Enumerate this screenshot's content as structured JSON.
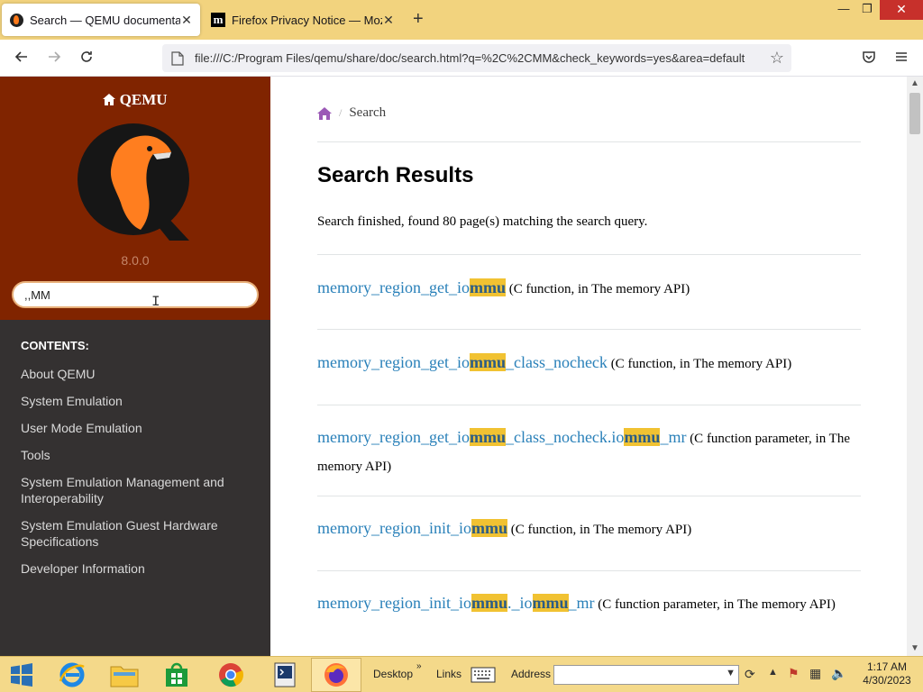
{
  "browser": {
    "tabs": [
      {
        "title": "Search — QEMU documentatio",
        "close": "✕",
        "favicon": "qemu-logo-icon",
        "active": true
      },
      {
        "title": "Firefox Privacy Notice — Mozilla",
        "close": "✕",
        "favicon": "mozilla-m-icon",
        "active": false
      }
    ],
    "new_tab": "+",
    "url": "file:///C:/Program Files/qemu/share/doc/search.html?q=%2C%2CMM&check_keywords=yes&area=default",
    "window_controls": {
      "minimize": "—",
      "maximize": "❐",
      "close": "✕"
    }
  },
  "sidebar": {
    "brand": "QEMU",
    "version": "8.0.0",
    "search_value": ",,MM",
    "contents_heading": "CONTENTS:",
    "nav_items": [
      "About QEMU",
      "System Emulation",
      "User Mode Emulation",
      "Tools",
      "System Emulation Management and Interoperability",
      "System Emulation Guest Hardware Specifications",
      "Developer Information"
    ]
  },
  "main": {
    "breadcrumb_current": "Search",
    "heading": "Search Results",
    "summary": "Search finished, found 80 page(s) matching the search query.",
    "results": [
      {
        "parts": [
          [
            "memory_region_get_io",
            false
          ],
          [
            "mmu",
            true
          ]
        ],
        "desc": " (C function, in The memory API)"
      },
      {
        "parts": [
          [
            "memory_region_get_io",
            false
          ],
          [
            "mmu",
            true
          ],
          [
            "_class_nocheck",
            false
          ]
        ],
        "desc": " (C function, in The memory API)"
      },
      {
        "parts": [
          [
            "memory_region_get_io",
            false
          ],
          [
            "mmu",
            true
          ],
          [
            "_class_nocheck.io",
            false
          ],
          [
            "mmu",
            true
          ],
          [
            "_mr",
            false
          ]
        ],
        "desc": " (C function parameter, in The memory API)"
      },
      {
        "parts": [
          [
            "memory_region_init_io",
            false
          ],
          [
            "mmu",
            true
          ]
        ],
        "desc": " (C function, in The memory API)"
      },
      {
        "parts": [
          [
            "memory_region_init_io",
            false
          ],
          [
            "mmu",
            true
          ],
          [
            "._io",
            false
          ],
          [
            "mmu",
            true
          ],
          [
            "_mr",
            false
          ]
        ],
        "desc": " (C function parameter, in The memory API)"
      }
    ]
  },
  "taskbar": {
    "desktop_label": "Desktop",
    "links_label": "Links",
    "address_label": "Address",
    "clock_time": "1:17 AM",
    "clock_date": "4/30/2023"
  },
  "colors": {
    "sidebar_top": "#802400",
    "sidebar_bottom": "#343131",
    "link": "#2980b9",
    "highlight": "#f1c232",
    "tabstrip": "#f2d37e"
  }
}
